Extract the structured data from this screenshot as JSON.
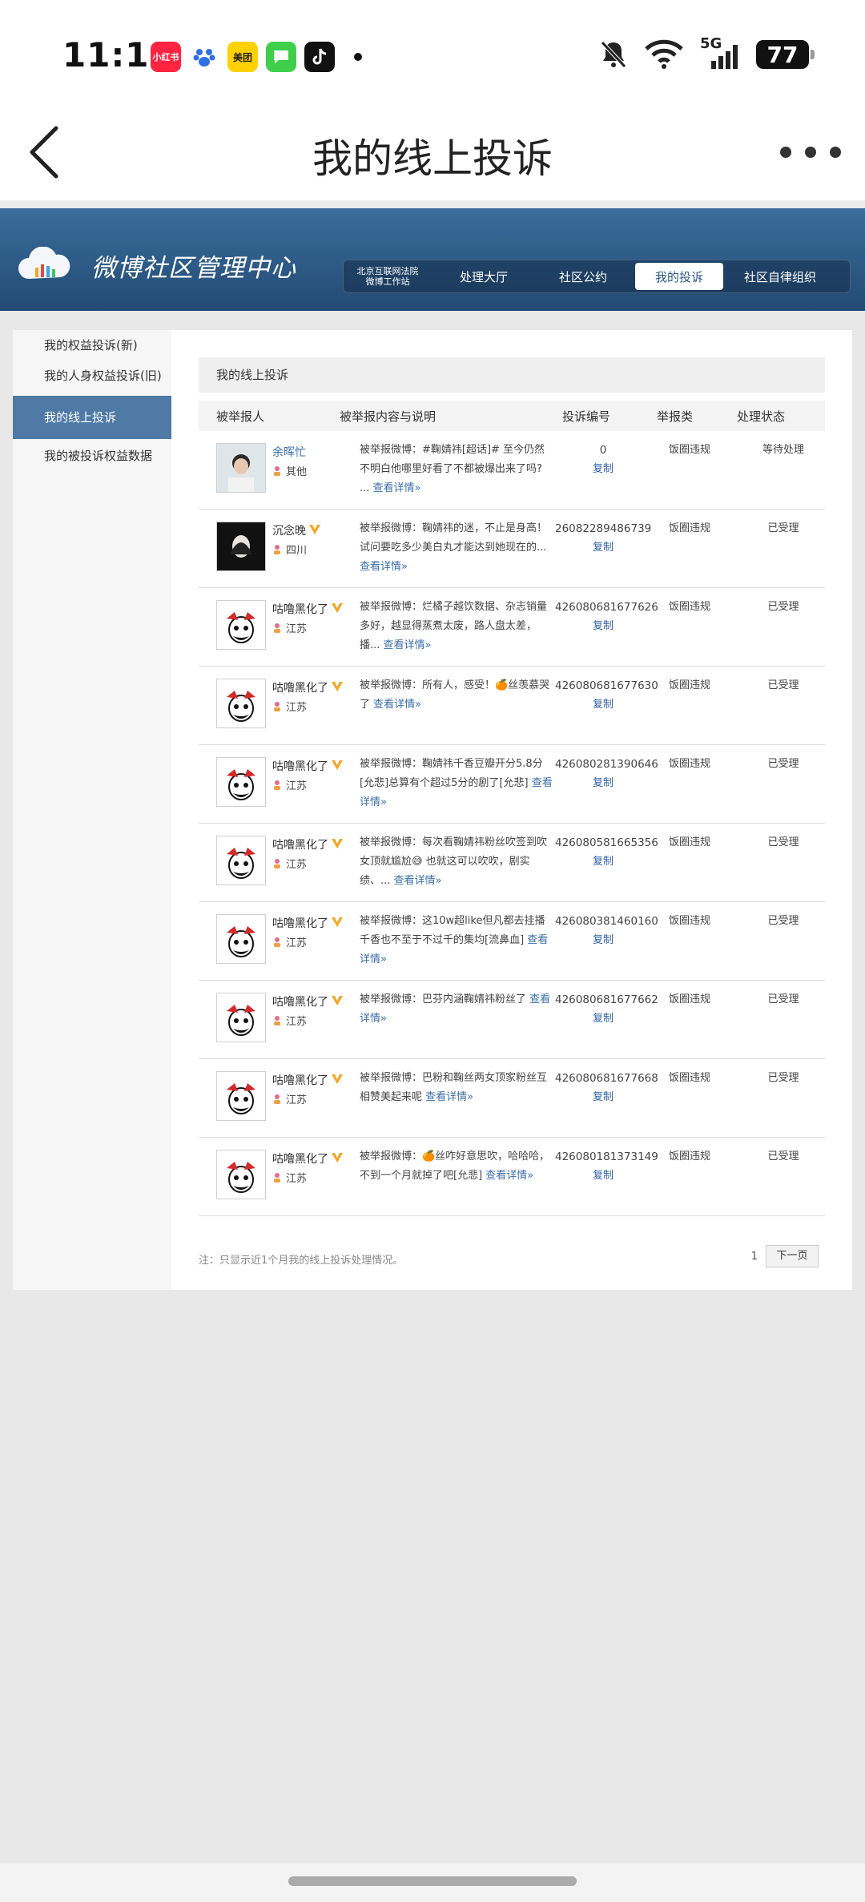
{
  "status_bar": {
    "time": "11:19",
    "apps": [
      {
        "name": "xiaohongshu-app-icon",
        "label": "小红书",
        "color": "#ff2442"
      },
      {
        "name": "baidu-app-icon",
        "label": "",
        "color": "#ffffff"
      },
      {
        "name": "meituan-app-icon",
        "label": "美团",
        "color": "#ffd100"
      },
      {
        "name": "messages-app-icon",
        "label": "",
        "color": "#3ecf4a"
      },
      {
        "name": "tiktok-app-icon",
        "label": "",
        "color": "#111111"
      }
    ],
    "network": "5G",
    "battery": "77"
  },
  "navbar": {
    "title": "我的线上投诉"
  },
  "banner": {
    "brand_title": "微博社区管理中心",
    "tabs": [
      {
        "label_line1": "北京互联网法院",
        "label_line2": "微博工作站"
      },
      {
        "label": "处理大厅"
      },
      {
        "label": "社区公约"
      },
      {
        "label": "我的投诉"
      },
      {
        "label": "社区自律组织"
      }
    ]
  },
  "sidebar": {
    "items": [
      {
        "label": "我的权益投诉(新)"
      },
      {
        "label": "我的人身权益投诉(旧)"
      },
      {
        "label": "我的线上投诉"
      },
      {
        "label": "我的被投诉权益数据"
      }
    ]
  },
  "main": {
    "panel_title": "我的线上投诉",
    "columns": [
      "被举报人",
      "被举报内容与说明",
      "投诉编号",
      "举报类",
      "处理状态"
    ],
    "view_more_label": "查看详情»",
    "copy_label": "复制",
    "rows": [
      {
        "user": "余晖忙",
        "location": "其他",
        "desc": "被举报微博：#鞠婧祎[超话]# 至今仍然不明白他哪里好看了不都被爆出来了吗? ...",
        "number": "0",
        "type": "饭圈违规",
        "status": "等待处理"
      },
      {
        "user": "沉念晚",
        "location": "四川",
        "desc": "被举报微博：鞠婧祎的迷，不止是身高！试问要吃多少美白丸才能达到她现在的...",
        "number": "26082289486739",
        "type": "饭圈违规",
        "status": "已受理"
      },
      {
        "user": "咕噜黑化了",
        "location": "江苏",
        "desc": "被举报微博：烂橘子越饮数据、杂志销量多好，越显得蒸煮太废，路人盘太差，播...",
        "number": "426080681677626",
        "type": "饭圈违规",
        "status": "已受理"
      },
      {
        "user": "咕噜黑化了",
        "location": "江苏",
        "desc": "被举报微博：所有人，感受！🍊丝羡慕哭了",
        "number": "426080681677630",
        "type": "饭圈违规",
        "status": "已受理"
      },
      {
        "user": "咕噜黑化了",
        "location": "江苏",
        "desc": "被举报微博：鞠婧祎千香豆瓣开分5.8分[允悲]总算有个超过5分的剧了[允悲]",
        "number": "426080281390646",
        "type": "饭圈违规",
        "status": "已受理"
      },
      {
        "user": "咕噜黑化了",
        "location": "江苏",
        "desc": "被举报微博：每次看鞠婧祎粉丝吹签到吹女顶就尴尬😅 也就这可以吹吹，剧实绩、...",
        "number": "426080581665356",
        "type": "饭圈违规",
        "status": "已受理"
      },
      {
        "user": "咕噜黑化了",
        "location": "江苏",
        "desc": "被举报微博：这10w超like但凡都去挂播千香也不至于不过千的集均[流鼻血]",
        "number": "426080381460160",
        "type": "饭圈违规",
        "status": "已受理"
      },
      {
        "user": "咕噜黑化了",
        "location": "江苏",
        "desc": "被举报微博：巴芬内涵鞠婧祎粉丝了",
        "number": "426080681677662",
        "type": "饭圈违规",
        "status": "已受理"
      },
      {
        "user": "咕噜黑化了",
        "location": "江苏",
        "desc": "被举报微博：巴粉和鞠丝两女顶家粉丝互相赞美起来呢",
        "number": "426080681677668",
        "type": "饭圈违规",
        "status": "已受理"
      },
      {
        "user": "咕噜黑化了",
        "location": "江苏",
        "desc": "被举报微博：🍊丝咋好意思吹，哈哈哈，不到一个月就掉了吧[允悲]",
        "number": "426080181373149",
        "type": "饭圈违规",
        "status": "已受理"
      }
    ],
    "note": "注：只显示近1个月我的线上投诉处理情况。",
    "page_number": "1",
    "next_label": "下一页"
  },
  "colors": {
    "banner": "#2d5a86",
    "sidebar_active": "#4f7aa6",
    "link": "#3a6ea8",
    "vip_badge": "#f5a623"
  }
}
